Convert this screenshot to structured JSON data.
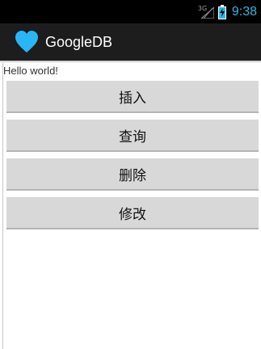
{
  "status_bar": {
    "network_type": "3G",
    "time": "9:38",
    "accent_color": "#33b5e5"
  },
  "action_bar": {
    "icon": "heart-icon",
    "icon_color": "#29b6f6",
    "title": "GoogleDB"
  },
  "main": {
    "text": "Hello world!",
    "buttons": [
      {
        "label": "插入"
      },
      {
        "label": "查询"
      },
      {
        "label": "删除"
      },
      {
        "label": "修改"
      }
    ]
  }
}
